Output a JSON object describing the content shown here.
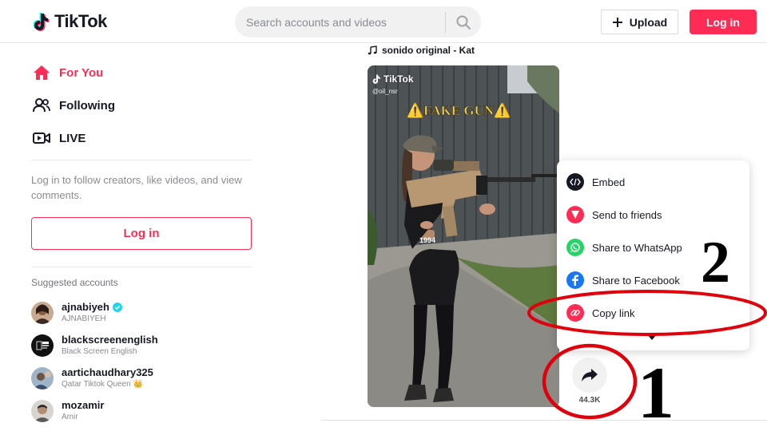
{
  "header": {
    "logo_text": "TikTok",
    "search_placeholder": "Search accounts and videos",
    "upload_label": "Upload",
    "login_label": "Log in"
  },
  "sidebar": {
    "nav": [
      {
        "label": "For You",
        "icon": "home-icon",
        "active": true
      },
      {
        "label": "Following",
        "icon": "users-icon",
        "active": false
      },
      {
        "label": "LIVE",
        "icon": "live-icon",
        "active": false
      }
    ],
    "prompt": "Log in to follow creators, like videos, and view comments.",
    "login_label": "Log in",
    "suggested_title": "Suggested accounts",
    "accounts": [
      {
        "username": "ajnabiyeh",
        "display": "AJNABIYEH",
        "verified": true
      },
      {
        "username": "blackscreenenglish",
        "display": "Black Screen English",
        "verified": false
      },
      {
        "username": "aartichaudhary325",
        "display": "Qatar Tiktok Queen 👑",
        "verified": false
      },
      {
        "username": "mozamir",
        "display": "Amir",
        "verified": false
      }
    ]
  },
  "feed": {
    "sound": "sonido original - Kat",
    "video": {
      "watermark": "TikTok",
      "handle": "@oil_nsr",
      "caption": "⚠️FAKE GUN⚠️",
      "shirt_text": "1994"
    },
    "share_count": "44.3K"
  },
  "share_menu": {
    "items": [
      {
        "label": "Embed",
        "icon": "embed-icon",
        "color": "#161823"
      },
      {
        "label": "Send to friends",
        "icon": "send-icon",
        "color": "#fe2c55"
      },
      {
        "label": "Share to WhatsApp",
        "icon": "whatsapp-icon",
        "color": "#25d366"
      },
      {
        "label": "Share to Facebook",
        "icon": "facebook-icon",
        "color": "#1877f2"
      },
      {
        "label": "Copy link",
        "icon": "link-icon",
        "color": "#fe2c55"
      }
    ]
  },
  "annotations": {
    "step_one": "1",
    "step_two": "2",
    "circle_color": "#e0000b"
  },
  "colors": {
    "brand": "#fe2c55",
    "text": "#161823",
    "muted": "#8a8b91"
  }
}
